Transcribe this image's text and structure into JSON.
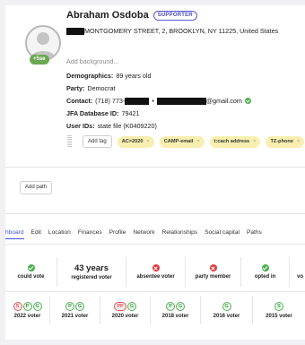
{
  "profile": {
    "name": "Abraham Osdoba",
    "badge": "SUPPORTER",
    "avatar_badge": "+5se",
    "address": "MONTGOMERY STREET, 2, BROOKLYN, NY 11225, United States",
    "add_background": "Add background...",
    "demographics_label": "Demographics:",
    "demographics_value": "89 years old",
    "party_label": "Party:",
    "party_value": "Democrat",
    "contact_label": "Contact:",
    "contact_phone_prefix": "(718) 773-",
    "contact_separator": "•",
    "contact_email_suffix": "@gmail.com",
    "jfa_label": "JFA Database ID:",
    "jfa_value": "79421",
    "userids_label": "User IDs:",
    "userids_value": "state file (K0409220)"
  },
  "tags": {
    "add_label": "Add tag",
    "items": [
      "AC>2020",
      "CAMP-email",
      "t:cach address",
      "TZ-phone"
    ],
    "remove_glyph": "×"
  },
  "add_path_label": "Add path",
  "tabs": [
    "hboard",
    "Edit",
    "Location",
    "Finances",
    "Profile",
    "Network",
    "Relationships",
    "Social capital",
    "Paths"
  ],
  "status": [
    {
      "icon": "check-icon",
      "label": "could vote"
    },
    {
      "big": "43 years",
      "label": "registered voter"
    },
    {
      "icon": "x-icon",
      "label": "absentee voter"
    },
    {
      "icon": "x-icon",
      "label": "party member"
    },
    {
      "icon": "check-icon",
      "label": "opted in"
    },
    {
      "label": "vo"
    }
  ],
  "voter_history": [
    {
      "badges": [
        "S",
        "P",
        "G"
      ],
      "colors": [
        "r",
        "g",
        "g"
      ],
      "label": "2022 voter"
    },
    {
      "badges": [
        "P",
        "G"
      ],
      "colors": [
        "g",
        "g"
      ],
      "label": "2021 voter"
    },
    {
      "badges": [
        "PP",
        "G"
      ],
      "colors": [
        "r",
        "g"
      ],
      "label": "2020 voter"
    },
    {
      "badges": [
        "P",
        "G"
      ],
      "colors": [
        "g",
        "g"
      ],
      "label": "2018 voter"
    },
    {
      "badges": [
        "G"
      ],
      "colors": [
        "g"
      ],
      "label": "2016 voter"
    },
    {
      "badges": [
        "S"
      ],
      "colors": [
        "g"
      ],
      "label": "2015 voter"
    }
  ],
  "colors": {
    "accent": "#3f51d8",
    "success": "#4caf50",
    "danger": "#e03a3a",
    "tag_bg": "#f8efb0"
  }
}
